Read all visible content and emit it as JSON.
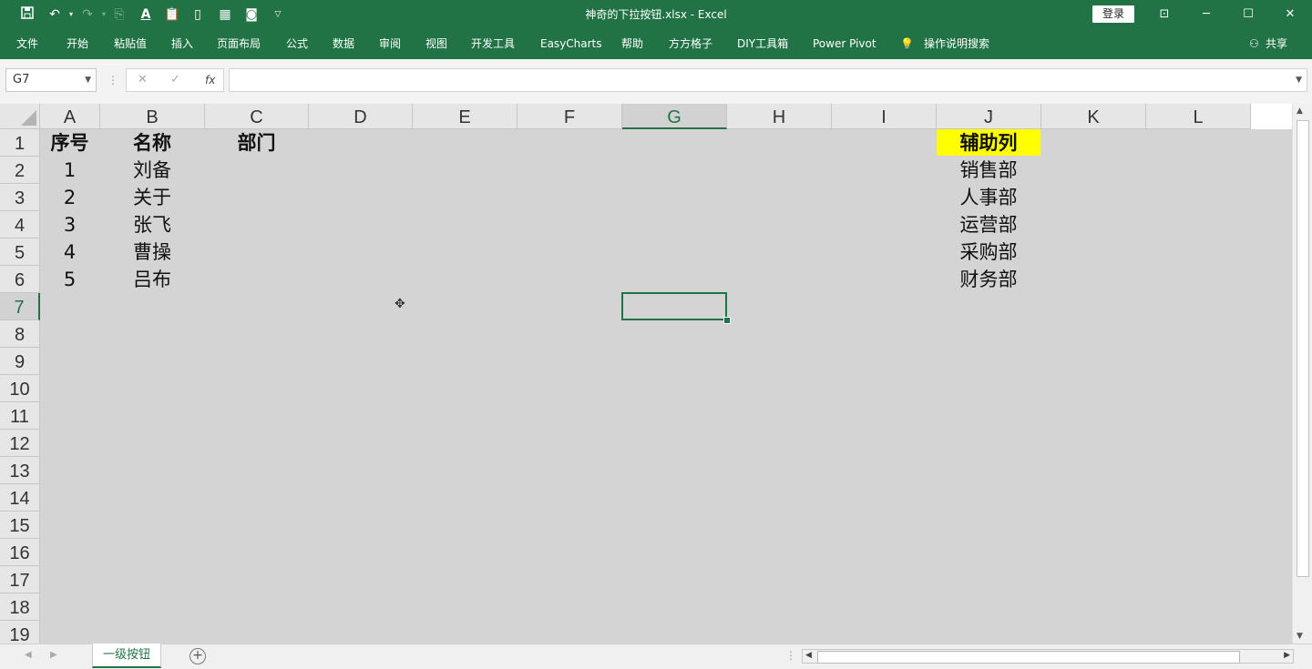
{
  "app": {
    "doc_title": "神奇的下拉按钮.xlsx  -  Excel",
    "login_label": "登录",
    "share_label": "共享",
    "colors": {
      "accent": "#217346",
      "highlight": "#ffff00"
    }
  },
  "quick_access": [
    "save-icon",
    "undo-icon",
    "redo-icon",
    "format-painter-icon",
    "font-color-icon",
    "paste-icon",
    "page-icon",
    "table-icon",
    "camera-icon",
    "customize-dropdown-icon"
  ],
  "ribbon_tabs": [
    "文件",
    "开始",
    "粘贴值",
    "插入",
    "页面布局",
    "公式",
    "数据",
    "审阅",
    "视图",
    "开发工具",
    "EasyCharts",
    "帮助",
    "方方格子",
    "DIY工具箱",
    "Power Pivot",
    "操作说明搜索"
  ],
  "formula_bar": {
    "name_box": "G7",
    "fx_label": "fx",
    "formula": ""
  },
  "columns": [
    "A",
    "B",
    "C",
    "D",
    "E",
    "F",
    "G",
    "H",
    "I",
    "J",
    "K",
    "L"
  ],
  "selected_column": "G",
  "rows": [
    "1",
    "2",
    "3",
    "4",
    "5",
    "6",
    "7",
    "8",
    "9",
    "10",
    "11",
    "12",
    "13",
    "14",
    "15",
    "16",
    "17",
    "18",
    "19"
  ],
  "selected_row": "7",
  "cells": {
    "A1": "序号",
    "B1": "名称",
    "C1": "部门",
    "J1": "辅助列",
    "A2": "1",
    "B2": "刘备",
    "J2": "销售部",
    "A3": "2",
    "B3": "关于",
    "J3": "人事部",
    "A4": "3",
    "B4": "张飞",
    "J4": "运营部",
    "A5": "4",
    "B5": "曹操",
    "J5": "采购部",
    "A6": "5",
    "B6": "吕布",
    "J6": "财务部"
  },
  "sheet_tabs": [
    "一级按钮"
  ]
}
